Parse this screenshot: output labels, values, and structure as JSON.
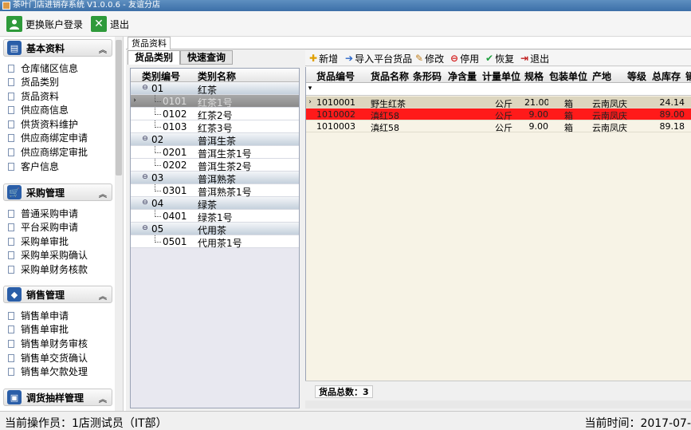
{
  "window": {
    "title": "茶叶门店进销存系统 V1.0.0.6 - 友谊分店"
  },
  "topbar": {
    "switch_login": "更换账户登录",
    "exit": "退出"
  },
  "sidebar": {
    "sections": [
      {
        "title": "基本资料",
        "items": [
          "仓库储区信息",
          "货品类别",
          "货品资料",
          "供应商信息",
          "供货资料维护",
          "供应商绑定申请",
          "供应商绑定审批",
          "客户信息"
        ]
      },
      {
        "title": "采购管理",
        "items": [
          "普通采购申请",
          "平台采购申请",
          "采购单审批",
          "采购单采购确认",
          "采购单财务核款"
        ]
      },
      {
        "title": "销售管理",
        "items": [
          "销售单申请",
          "销售单审批",
          "销售单财务审核",
          "销售单交货确认",
          "销售单欠款处理"
        ]
      },
      {
        "title": "调货抽样管理",
        "items": []
      }
    ]
  },
  "main_tab": {
    "label": "货品资料"
  },
  "category_tabs": {
    "active": "货品类别",
    "inactive": "快速查询"
  },
  "category_grid": {
    "headers": {
      "code": "类别编号",
      "name": "类别名称"
    },
    "rows": [
      {
        "code": "01",
        "name": "红茶",
        "level": 0
      },
      {
        "code": "0101",
        "name": "红茶1号",
        "level": 1,
        "selected": true
      },
      {
        "code": "0102",
        "name": "红茶2号",
        "level": 1
      },
      {
        "code": "0103",
        "name": "红茶3号",
        "level": 1
      },
      {
        "code": "02",
        "name": "普洱生茶",
        "level": 0
      },
      {
        "code": "0201",
        "name": "普洱生茶1号",
        "level": 1
      },
      {
        "code": "0202",
        "name": "普洱生茶2号",
        "level": 1
      },
      {
        "code": "03",
        "name": "普洱熟茶",
        "level": 0
      },
      {
        "code": "0301",
        "name": "普洱熟茶1号",
        "level": 1
      },
      {
        "code": "04",
        "name": "绿茶",
        "level": 0
      },
      {
        "code": "0401",
        "name": "绿茶1号",
        "level": 1
      },
      {
        "code": "05",
        "name": "代用茶",
        "level": 0
      },
      {
        "code": "0501",
        "name": "代用茶1号",
        "level": 1
      }
    ]
  },
  "goods_toolbar": {
    "add": "新增",
    "import": "导入平台货品",
    "edit": "修改",
    "disable": "停用",
    "restore": "恢复",
    "exit": "退出"
  },
  "goods_grid": {
    "headers": [
      "货品编号",
      "货品名称",
      "条形码",
      "净含量",
      "计量单位",
      "规格",
      "包装单位",
      "产地",
      "等级",
      "总库存",
      "销"
    ],
    "rows": [
      {
        "id": "1010001",
        "name": "野生红茶",
        "barcode": "",
        "net": "",
        "unit": "公斤",
        "spec": "21.00",
        "pack": "箱",
        "origin": "云南凤庆",
        "grade": "",
        "stock": "24.14",
        "style": "normal"
      },
      {
        "id": "1010002",
        "name": "滇红58",
        "barcode": "",
        "net": "",
        "unit": "公斤",
        "spec": "9.00",
        "pack": "箱",
        "origin": "云南凤庆",
        "grade": "",
        "stock": "89.00",
        "style": "red"
      },
      {
        "id": "1010003",
        "name": "滇红58",
        "barcode": "",
        "net": "",
        "unit": "公斤",
        "spec": "9.00",
        "pack": "箱",
        "origin": "云南凤庆",
        "grade": "",
        "stock": "89.18",
        "style": "plain"
      }
    ],
    "total_label": "货品总数：3"
  },
  "status": {
    "operator": "当前操作员：1店测试员（IT部）",
    "time": "当前时间：2017-07-"
  },
  "colors": {
    "red_row": "#ff1a1a",
    "sidebar_icon": "#2a5ea8",
    "green_icon": "#2e9a3a"
  }
}
